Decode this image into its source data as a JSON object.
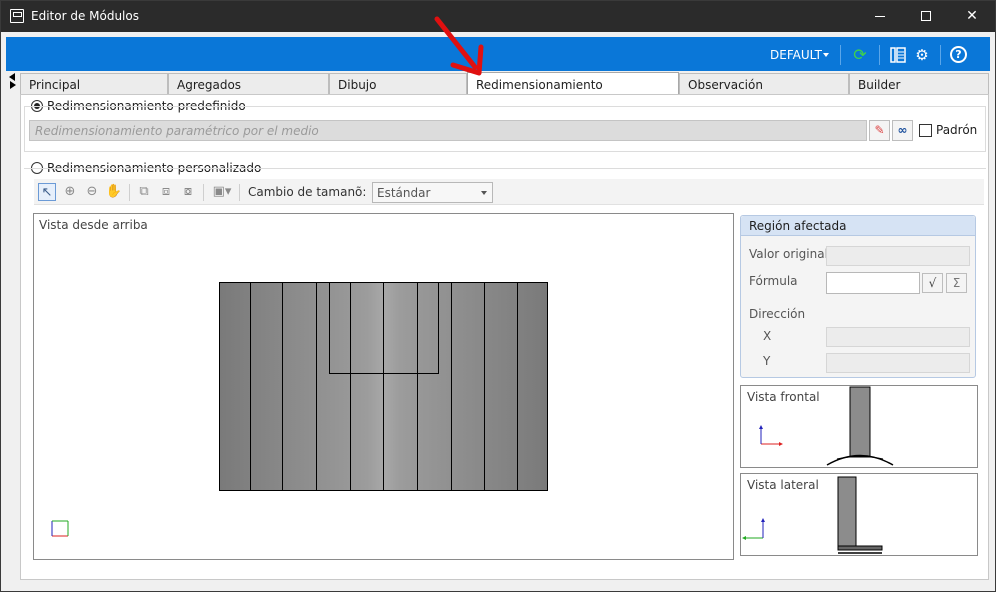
{
  "window": {
    "title": "Editor de Módulos"
  },
  "toolbar": {
    "profile": "DEFAULT"
  },
  "tabs": [
    "Principal",
    "Agregados",
    "Dibujo",
    "Redimensionamiento",
    "Observación",
    "Builder"
  ],
  "active_tab": "Redimensionamiento",
  "predefined": {
    "label": "Redimensionamiento predefinido",
    "value": "Redimensionamiento paramétrico por el medio",
    "checkbox_label": "Padrón"
  },
  "custom": {
    "label": "Redimensionamiento personalizado",
    "resize_label": "Cambio de tamanõ:",
    "resize_value": "Estándar"
  },
  "views": {
    "top": "Vista desde arriba",
    "front": "Vista frontal",
    "side": "Vista lateral"
  },
  "region": {
    "title": "Región afectada",
    "original_label": "Valor original",
    "formula_label": "Fórmula",
    "direction_label": "Dirección",
    "x_label": "X",
    "y_label": "Y",
    "sqrt_symbol": "√",
    "sum_symbol": "Σ"
  }
}
